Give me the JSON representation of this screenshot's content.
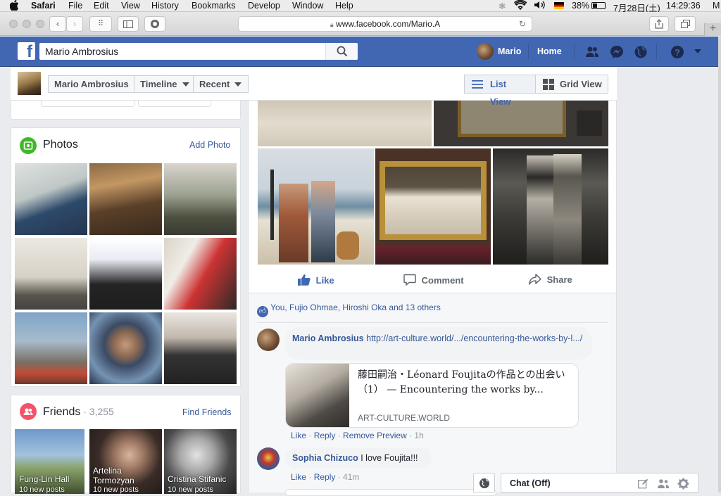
{
  "menubar": {
    "apple_icon": "apple-icon",
    "items": [
      "Safari",
      "File",
      "Edit",
      "View",
      "History",
      "Bookmarks",
      "Develop",
      "Window",
      "Help"
    ],
    "battery": "38%",
    "date": "7月28日(土)",
    "time": "14:29:36",
    "user_initial": "M"
  },
  "browser": {
    "url": "www.facebook.com/Mario.A"
  },
  "fb_header": {
    "search_value": "Mario Ambrosius",
    "profile_name": "Mario",
    "home_label": "Home"
  },
  "timeline_nav": {
    "name": "Mario Ambrosius",
    "timeline_label": "Timeline",
    "recent_label": "Recent",
    "list_view_label": "List View",
    "grid_view_label": "Grid View"
  },
  "photos_card": {
    "title": "Photos",
    "add_label": "Add Photo"
  },
  "friends_card": {
    "title": "Friends",
    "count": " · 3,255",
    "find_label": "Find Friends",
    "friends": [
      {
        "name": "Fung-Lin Hall",
        "posts": "10 new posts"
      },
      {
        "name": "Artelina Tormozyan",
        "posts": "10 new posts"
      },
      {
        "name": "Cristina Stifanic",
        "posts": "10 new posts"
      }
    ]
  },
  "post": {
    "like_label": "Like",
    "comment_label": "Comment",
    "share_label": "Share",
    "reactions_text": "You, Fujio Ohmae, Hiroshi Oka and 13 others"
  },
  "comments": [
    {
      "author": "Mario Ambrosius",
      "link_text": "http://art-culture.world/.../encountering-the-works-by-l.../",
      "preview": {
        "title": "藤田嗣治・Léonard Foujitaの作品との出会い（1） — Encountering the works by...",
        "domain": "ART-CULTURE.WORLD"
      },
      "actions": {
        "like": "Like",
        "reply": "Reply",
        "remove": "Remove Preview",
        "time": "1h"
      }
    },
    {
      "author": "Sophia Chizuco",
      "text": "I love Foujita!!!",
      "actions": {
        "like": "Like",
        "reply": "Reply",
        "time": "41m"
      }
    }
  ],
  "chat": {
    "label": "Chat (Off)"
  },
  "colors": {
    "fb_blue": "#4267b2",
    "link_blue": "#365899",
    "page_bg": "#e9ebee"
  }
}
